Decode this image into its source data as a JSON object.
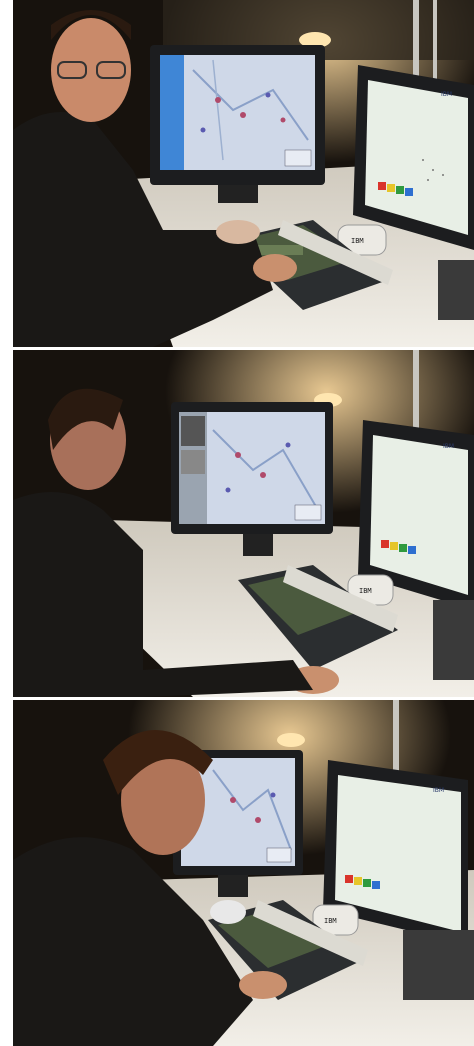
{
  "photos": [
    {
      "id": "photo-1",
      "description_name": "user-facing-camera",
      "monitor_brand": "IBM",
      "scanner_label": "IBM"
    },
    {
      "id": "photo-2",
      "description_name": "user-side-profile",
      "monitor_brand": "IBM",
      "scanner_label": "IBM"
    },
    {
      "id": "photo-3",
      "description_name": "user-leaning-forward",
      "monitor_brand": "IBM",
      "scanner_label": "IBM"
    }
  ],
  "colors": {
    "background": "#120e0a",
    "desk": "#e8e4dc",
    "map_screen": "#cfd8e8",
    "chart_screen": "#e8efe6",
    "lamp_glow": "#ffd48a",
    "device_gray": "#2b2e30",
    "color_swatches": [
      "#d9342b",
      "#e6c52a",
      "#2f9a3f",
      "#2e6fd0"
    ]
  }
}
